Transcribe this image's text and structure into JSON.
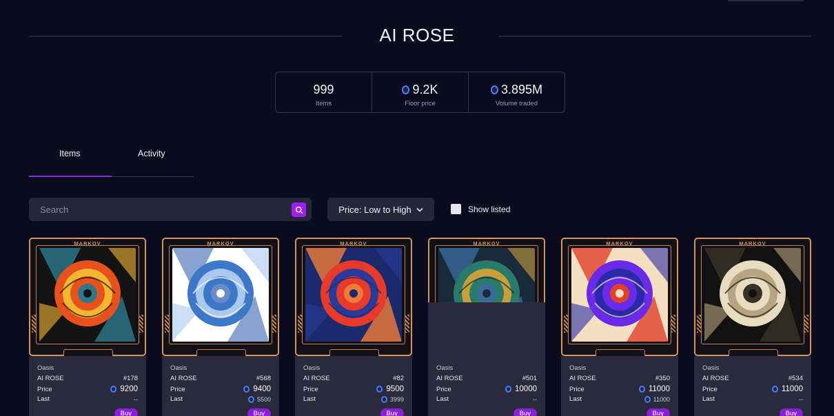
{
  "collection": {
    "title": "AI ROSE"
  },
  "stats": [
    {
      "value": "999",
      "label": "Items",
      "coin": false
    },
    {
      "value": "9.2K",
      "label": "Floor price",
      "coin": true
    },
    {
      "value": "3.895M",
      "label": "Volume traded",
      "coin": true
    }
  ],
  "tabs": {
    "items": "Items",
    "activity": "Activity"
  },
  "search": {
    "placeholder": "Search"
  },
  "sort": {
    "selected": "Price: Low to High"
  },
  "filter": {
    "show_listed": "Show listed"
  },
  "card_common": {
    "brand": "MARKOV",
    "price_label": "Price",
    "last_label": "Last",
    "buy": "Buy"
  },
  "cards": [
    {
      "collection": "Oasis",
      "name": "AI ROSE",
      "id": "#178",
      "price": "9200",
      "last": "--",
      "palette": [
        "#e8501c",
        "#f2b630",
        "#2a7a8c",
        "#141414"
      ]
    },
    {
      "collection": "Oasis",
      "name": "AI ROSE",
      "id": "#568",
      "price": "9400",
      "last": "5500",
      "palette": [
        "#3d78c8",
        "#a8c8ee",
        "#6a8cc4",
        "#ffffff"
      ]
    },
    {
      "collection": "Oasis",
      "name": "AI ROSE",
      "id": "#82",
      "price": "9500",
      "last": "3999",
      "palette": [
        "#e83a2a",
        "#2a3a9a",
        "#f07a3a",
        "#1a2a6a"
      ]
    },
    {
      "collection": "Oasis",
      "name": "AI ROSE",
      "id": "#501",
      "price": "10000",
      "last": "--",
      "palette": [
        "#2a7a6a",
        "#c8a03a",
        "#3a6a9a",
        "#1a2a3a"
      ]
    },
    {
      "collection": "Oasis",
      "name": "AI ROSE",
      "id": "#350",
      "price": "11000",
      "last": "11000",
      "palette": [
        "#6a2ae8",
        "#2a2aa8",
        "#e0402a",
        "#f4e0c0"
      ]
    },
    {
      "collection": "Oasis",
      "name": "AI ROSE",
      "id": "#534",
      "price": "11000",
      "last": "--",
      "palette": [
        "#e8dcc0",
        "#b8a480",
        "#3a3228",
        "#121212"
      ]
    }
  ]
}
